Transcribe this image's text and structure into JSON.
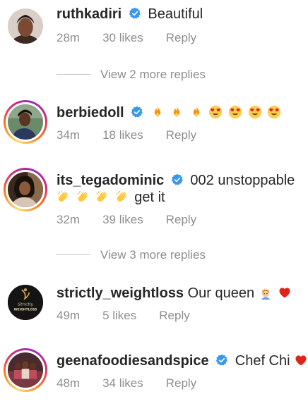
{
  "comments": [
    {
      "username": "ruthkadiri",
      "verified": true,
      "text": "Beautiful",
      "time": "28m",
      "likes": "30 likes",
      "reply": "Reply",
      "story_ring": false
    },
    {
      "username": "berbiedoll",
      "verified": true,
      "text": "",
      "emojis": [
        "fire",
        "fire",
        "fire",
        "heart-eyes",
        "heart-eyes",
        "heart-eyes",
        "heart-eyes"
      ],
      "time": "34m",
      "likes": "18 likes",
      "reply": "Reply",
      "story_ring": true
    },
    {
      "username": "its_tegadominic",
      "verified": true,
      "text": "002 unstoppable",
      "text2": "get it",
      "emojis": [
        "clapping-hands",
        "clapping-hands",
        "clapping-hands",
        "clapping-hands"
      ],
      "time": "32m",
      "likes": "39 likes",
      "reply": "Reply",
      "story_ring": true
    },
    {
      "username": "strictly_weightloss",
      "verified": false,
      "text": "Our queen",
      "emojis": [
        "woman-with-crown",
        "red-heart"
      ],
      "avatar_text": "STRICTLY WEIGHTLOSS",
      "time": "49m",
      "likes": "5 likes",
      "reply": "Reply",
      "story_ring": false
    },
    {
      "username": "geenafoodiesandspice",
      "verified": true,
      "text": "Chef Chi",
      "emojis": [
        "red-heart"
      ],
      "time": "48m",
      "likes": "34 likes",
      "reply": "Reply",
      "story_ring": true
    }
  ],
  "view_more": [
    {
      "label": "View 2 more replies"
    },
    {
      "label": "View 3 more replies"
    }
  ],
  "colors": {
    "verified": "#3897f0",
    "meta": "#8e8e8e",
    "text": "#262626",
    "heart": "#e0241b"
  }
}
